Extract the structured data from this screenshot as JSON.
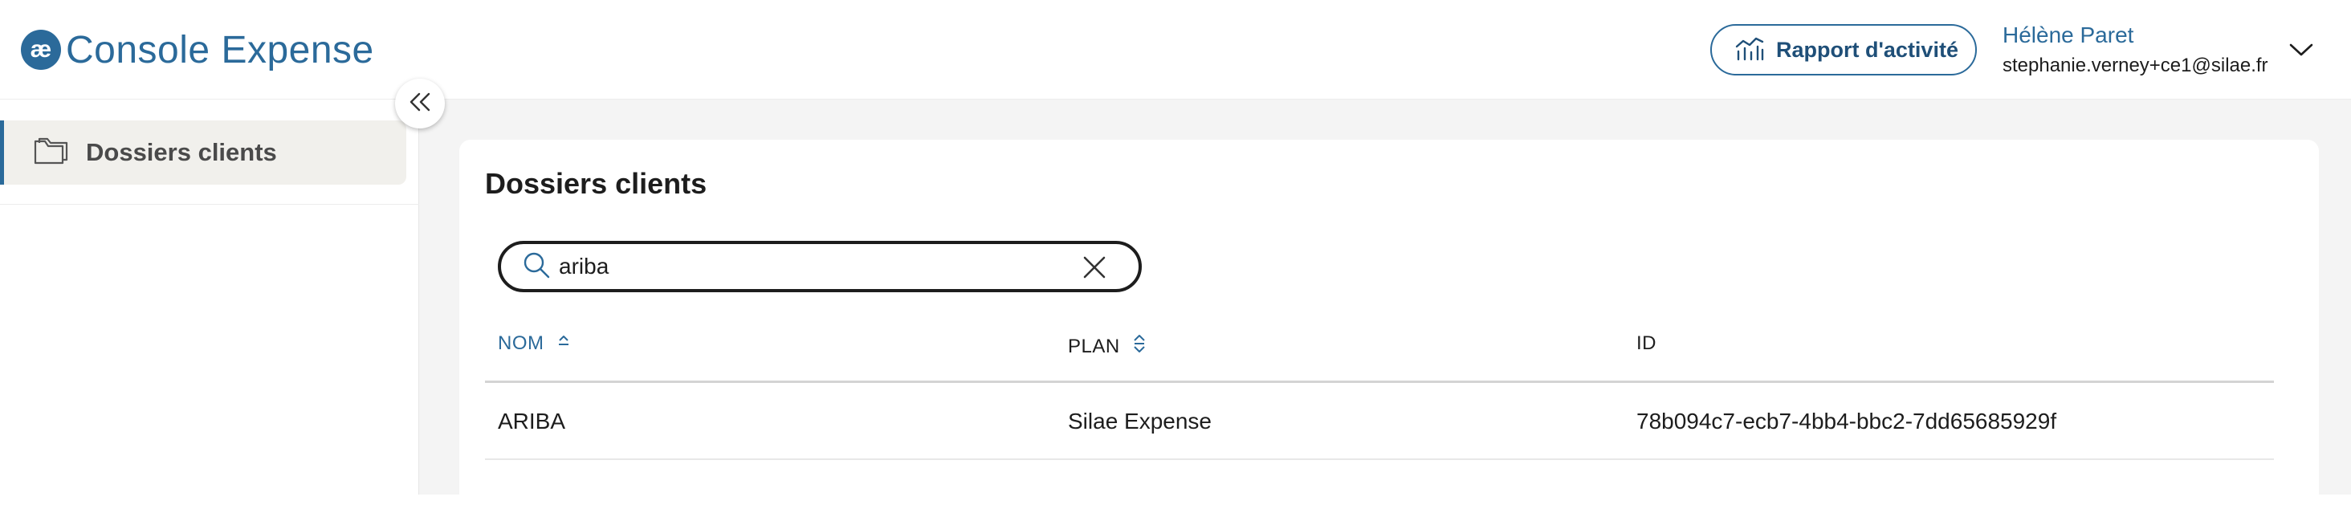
{
  "header": {
    "logo_mark": "æ",
    "app_title": "Console Expense",
    "report_button_label": "Rapport d'activité",
    "user_name": "Hélène Paret",
    "user_email": "stephanie.verney+ce1@silae.fr"
  },
  "sidebar": {
    "items": [
      {
        "label": "Dossiers clients",
        "icon": "folder-icon",
        "active": true
      }
    ],
    "collapse_icon": "double-chevron-left-icon"
  },
  "main": {
    "title": "Dossiers clients",
    "search": {
      "value": "ariba",
      "placeholder": ""
    },
    "table": {
      "columns": [
        {
          "label": "NOM",
          "sort": "ascending"
        },
        {
          "label": "PLAN",
          "sort": "sortable"
        },
        {
          "label": "ID",
          "sort": "none"
        }
      ],
      "rows": [
        {
          "nom": "ARIBA",
          "plan": "Silae Expense",
          "id": "78b094c7-ecb7-4bb4-bbc2-7dd65685929f"
        }
      ]
    }
  },
  "colors": {
    "accent": "#2b6a9a",
    "background": "#f4f4f4",
    "active_item_bg": "#f1f0ec"
  }
}
